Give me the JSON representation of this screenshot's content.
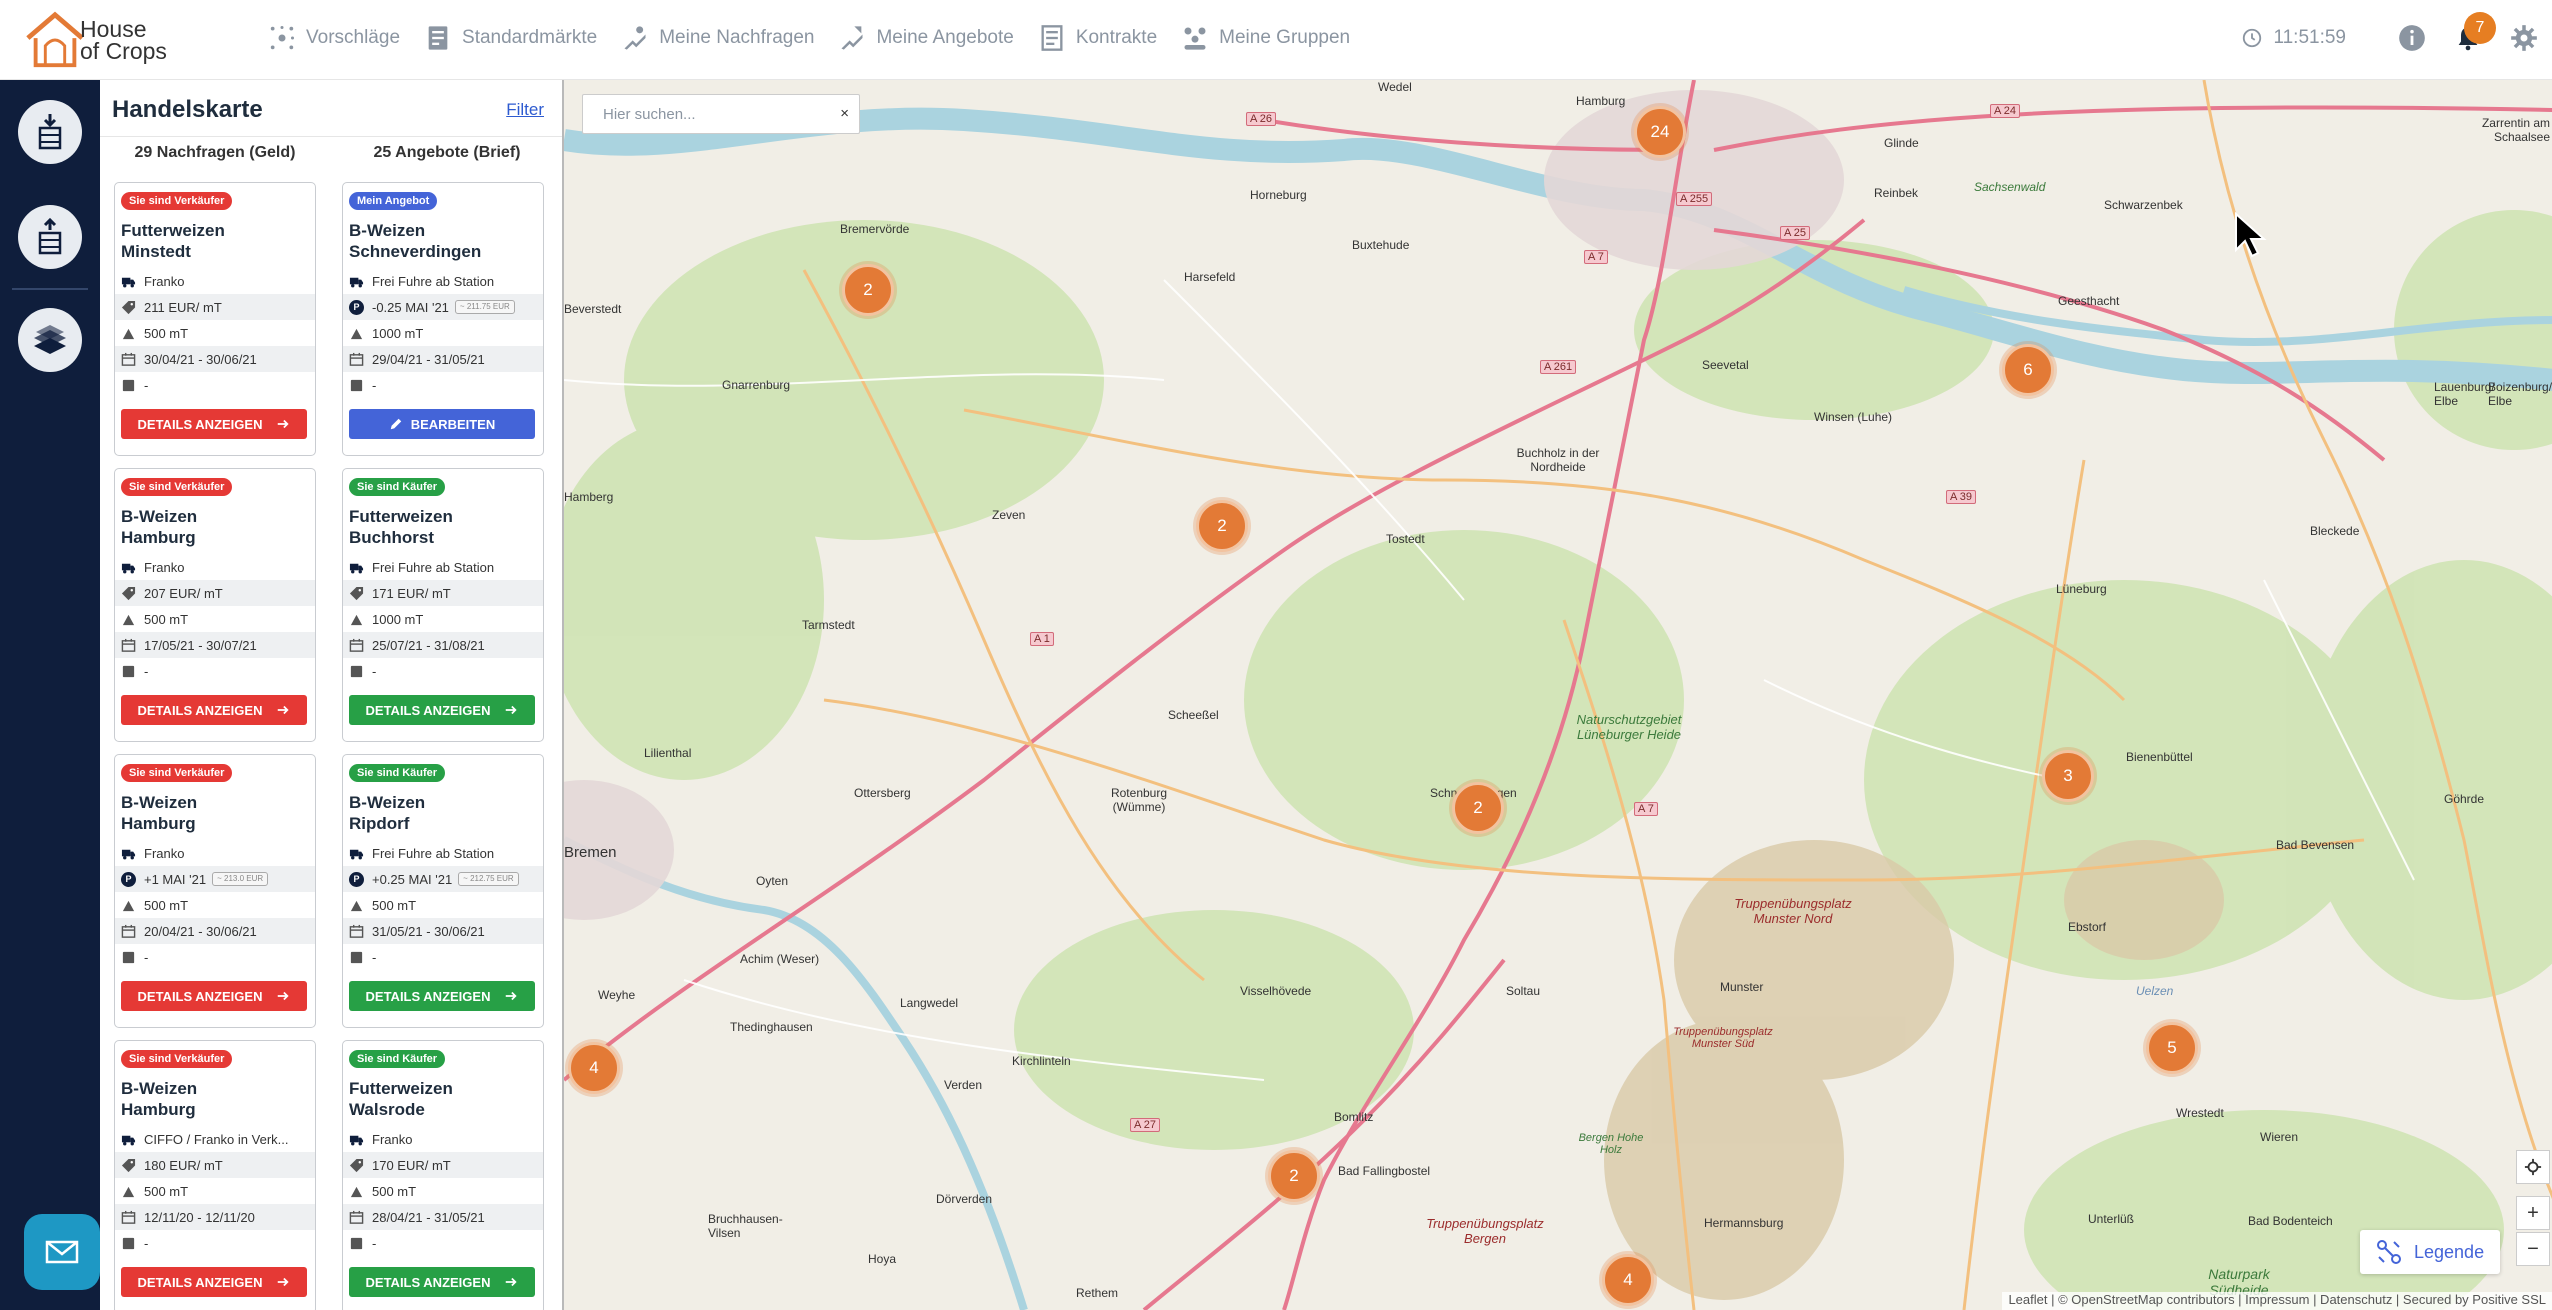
{
  "app": {
    "logo_line1": "House",
    "logo_line2": "of Crops",
    "clock": "11:51:59",
    "notification_count": "7",
    "nav": [
      {
        "label": "Vorschläge",
        "icon": "suggestions-icon"
      },
      {
        "label": "Standardmärkte",
        "icon": "standard-markets-icon"
      },
      {
        "label": "Meine Nachfragen",
        "icon": "requests-icon"
      },
      {
        "label": "Meine Angebote",
        "icon": "offers-icon"
      },
      {
        "label": "Kontrakte",
        "icon": "contracts-icon"
      },
      {
        "label": "Meine Gruppen",
        "icon": "groups-icon"
      }
    ]
  },
  "panel": {
    "title": "Handelskarte",
    "filter_label": "Filter",
    "col_left_heading": "29 Nachfragen (Geld)",
    "col_right_heading": "25 Angebote (Brief)",
    "left_cards": [
      {
        "badge": "Sie sind Verkäufer",
        "title1": "Futterweizen",
        "title2": "Minstedt",
        "delivery": "Franko",
        "price": "211 EUR/ mT",
        "price_chip": "",
        "qty": "500 mT",
        "period": "30/04/21 - 30/06/21",
        "extra": "-",
        "button": "DETAILS ANZEIGEN"
      },
      {
        "badge": "Sie sind Verkäufer",
        "title1": "B-Weizen",
        "title2": "Hamburg",
        "delivery": "Franko",
        "price": "207 EUR/ mT",
        "price_chip": "",
        "qty": "500 mT",
        "period": "17/05/21 - 30/07/21",
        "extra": "-",
        "button": "DETAILS ANZEIGEN"
      },
      {
        "badge": "Sie sind Verkäufer",
        "title1": "B-Weizen",
        "title2": "Hamburg",
        "delivery": "Franko",
        "price": "+1 MAI '21",
        "price_chip": "~ 213.0 EUR",
        "qty": "500 mT",
        "period": "20/04/21 - 30/06/21",
        "extra": "-",
        "button": "DETAILS ANZEIGEN"
      },
      {
        "badge": "Sie sind Verkäufer",
        "title1": "B-Weizen",
        "title2": "Hamburg",
        "delivery": "CIFFO / Franko in Verk...",
        "price": "180 EUR/ mT",
        "price_chip": "",
        "qty": "500 mT",
        "period": "12/11/20 - 12/11/20",
        "extra": "-",
        "button": "DETAILS ANZEIGEN"
      }
    ],
    "right_cards": [
      {
        "badge": "Mein Angebot",
        "title1": "B-Weizen",
        "title2": "Schneverdingen",
        "delivery": "Frei Fuhre ab Station",
        "price": "-0.25 MAI '21",
        "price_chip": "~ 211.75 EUR",
        "qty": "1000 mT",
        "period": "29/04/21 - 31/05/21",
        "extra": "-",
        "button": "BEARBEITEN"
      },
      {
        "badge": "Sie sind Käufer",
        "title1": "Futterweizen",
        "title2": "Buchhorst",
        "delivery": "Frei Fuhre ab Station",
        "price": "171 EUR/ mT",
        "price_chip": "",
        "qty": "1000 mT",
        "period": "25/07/21 - 31/08/21",
        "extra": "-",
        "button": "DETAILS ANZEIGEN"
      },
      {
        "badge": "Sie sind Käufer",
        "title1": "B-Weizen",
        "title2": "Ripdorf",
        "delivery": "Frei Fuhre ab Station",
        "price": "+0.25 MAI '21",
        "price_chip": "~ 212.75 EUR",
        "qty": "500 mT",
        "period": "31/05/21 - 30/06/21",
        "extra": "-",
        "button": "DETAILS ANZEIGEN"
      },
      {
        "badge": "Sie sind Käufer",
        "title1": "Futterweizen",
        "title2": "Walsrode",
        "delivery": "Franko",
        "price": "170 EUR/ mT",
        "price_chip": "",
        "qty": "500 mT",
        "period": "28/04/21 - 31/05/21",
        "extra": "-",
        "button": "DETAILS ANZEIGEN"
      }
    ]
  },
  "map": {
    "search_placeholder": "Hier suchen...",
    "search_clear": "×",
    "legend_label": "Legende",
    "attribution": "Leaflet | © OpenStreetMap contributors | Impressum | Datenschutz | Secured by Positive SSL",
    "zoom_in": "+",
    "zoom_out": "−",
    "clusters": [
      "24",
      "2",
      "6",
      "2",
      "2",
      "3",
      "4",
      "5",
      "2",
      "4"
    ],
    "places": [
      "Wedel",
      "Hamburg",
      "Glinde",
      "Reinbek",
      "Sachsenwald",
      "Schwarzenbek",
      "Zarrentin am Schaalsee",
      "Bremervörde",
      "Horneburg",
      "Buxtehude",
      "Harsefeld",
      "Geesthacht",
      "Beverstedt",
      "Gnarrenburg",
      "Seevetal",
      "Winsen (Luhe)",
      "Lauenburg/ Elbe",
      "Boizenburg/ Elbe",
      "Buchholz in der Nordheide",
      "Hamberg",
      "Zeven",
      "Tostedt",
      "Bleckede",
      "Lüneburg",
      "Tarmstedt",
      "Scheeßel",
      "Naturschutzgebiet Lüneburger Heide",
      "Lilienthal",
      "Ottersberg",
      "Rotenburg (Wümme)",
      "Schneverdingen",
      "Bienenbüttel",
      "Göhrde",
      "Bad Bevensen",
      "Oyten",
      "Truppenübungsplatz Munster Nord",
      "Ebstorf",
      "Achim (Weser)",
      "Langwedel",
      "Visselhövede",
      "Soltau",
      "Munster",
      "Truppenübungsplatz Munster Süd",
      "Uelzen",
      "Weyhe",
      "Thedinghausen",
      "Kirchlinteln",
      "Verden",
      "Bad Fallingbostel",
      "Bomlitz",
      "Wrestedt",
      "Dörverden",
      "Bergen Hohe Holz",
      "Hermannsburg",
      "Wieren",
      "Bruchhausen-Vilsen",
      "Hoya",
      "Rethem",
      "Truppenübungsplatz Bergen",
      "Unterlüß",
      "Bad Bodenteich",
      "Naturpark Südheide",
      "Bremen"
    ],
    "highways": [
      "A 26",
      "A 24",
      "A 255",
      "A 25",
      "A 7",
      "A 261",
      "A 39",
      "A 1",
      "A 7",
      "A 27"
    ]
  }
}
